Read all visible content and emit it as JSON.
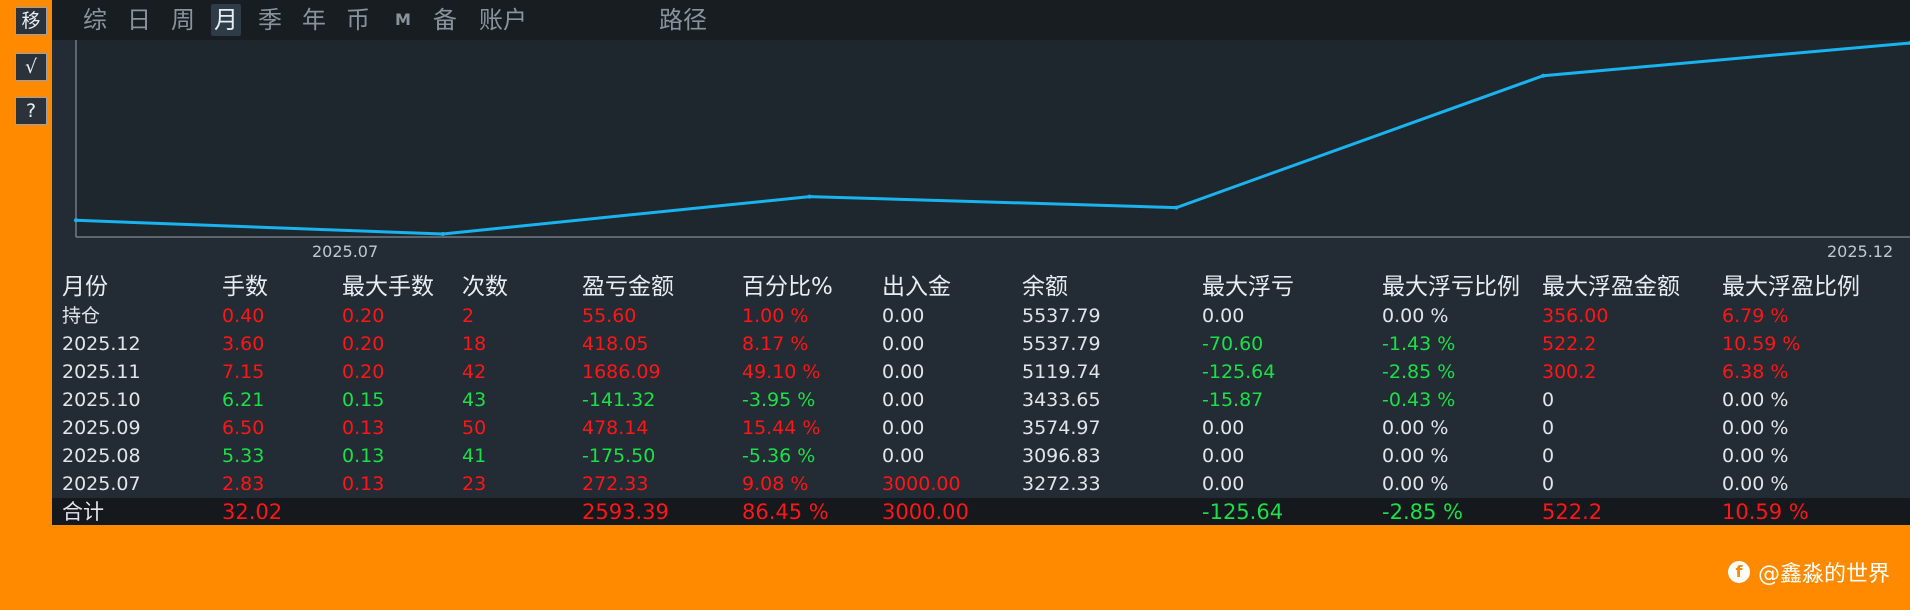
{
  "side_buttons": [
    "移",
    "√",
    "?"
  ],
  "tabs": [
    "综",
    "日",
    "周",
    "月",
    "季",
    "年",
    "币",
    "M",
    "备",
    "账户",
    "路径"
  ],
  "active_tab": "月",
  "chart_data": {
    "type": "line",
    "x": [
      "2025.07",
      "2025.08",
      "2025.09",
      "2025.10",
      "2025.11",
      "2025.12"
    ],
    "series": [
      {
        "values": [
          3272.33,
          3096.83,
          3574.97,
          3433.65,
          5119.74,
          5537.79
        ]
      }
    ],
    "xticks": [
      "2025.07",
      "2025.12"
    ],
    "line_color": "#19b4f0",
    "grid": false
  },
  "table": {
    "headers": [
      "月份",
      "手数",
      "最大手数",
      "次数",
      "盈亏金额",
      "百分比%",
      "出入金",
      "余额",
      "最大浮亏",
      "最大浮亏比例",
      "最大浮盈金额",
      "最大浮盈比例"
    ],
    "rows": [
      [
        "持仓",
        "0.40",
        "0.20",
        "2",
        "55.60",
        "1.00 %",
        "0.00",
        "5537.79",
        "0.00",
        "0.00 %",
        "356.00",
        "6.79 %"
      ],
      [
        "2025.12",
        "3.60",
        "0.20",
        "18",
        "418.05",
        "8.17 %",
        "0.00",
        "5537.79",
        "-70.60",
        "-1.43 %",
        "522.2",
        "10.59 %"
      ],
      [
        "2025.11",
        "7.15",
        "0.20",
        "42",
        "1686.09",
        "49.10 %",
        "0.00",
        "5119.74",
        "-125.64",
        "-2.85 %",
        "300.2",
        "6.38 %"
      ],
      [
        "2025.10",
        "6.21",
        "0.15",
        "43",
        "-141.32",
        "-3.95 %",
        "0.00",
        "3433.65",
        "-15.87",
        "-0.43 %",
        "0",
        "0.00 %"
      ],
      [
        "2025.09",
        "6.50",
        "0.13",
        "50",
        "478.14",
        "15.44 %",
        "0.00",
        "3574.97",
        "0.00",
        "0.00 %",
        "0",
        "0.00 %"
      ],
      [
        "2025.08",
        "5.33",
        "0.13",
        "41",
        "-175.50",
        "-5.36 %",
        "0.00",
        "3096.83",
        "0.00",
        "0.00 %",
        "0",
        "0.00 %"
      ],
      [
        "2025.07",
        "2.83",
        "0.13",
        "23",
        "272.33",
        "9.08 %",
        "3000.00",
        "3272.33",
        "0.00",
        "0.00 %",
        "0",
        "0.00 %"
      ]
    ],
    "row_colors": [
      [
        "w",
        "r",
        "r",
        "r",
        "r",
        "r",
        "w",
        "w",
        "w",
        "w",
        "r",
        "r"
      ],
      [
        "w",
        "r",
        "r",
        "r",
        "r",
        "r",
        "w",
        "w",
        "g",
        "g",
        "r",
        "r"
      ],
      [
        "w",
        "r",
        "r",
        "r",
        "r",
        "r",
        "w",
        "w",
        "g",
        "g",
        "r",
        "r"
      ],
      [
        "w",
        "g",
        "g",
        "g",
        "g",
        "g",
        "w",
        "w",
        "g",
        "g",
        "w",
        "w"
      ],
      [
        "w",
        "r",
        "r",
        "r",
        "r",
        "r",
        "w",
        "w",
        "w",
        "w",
        "w",
        "w"
      ],
      [
        "w",
        "g",
        "g",
        "g",
        "g",
        "g",
        "w",
        "w",
        "w",
        "w",
        "w",
        "w"
      ],
      [
        "w",
        "r",
        "r",
        "r",
        "r",
        "r",
        "r",
        "w",
        "w",
        "w",
        "w",
        "w"
      ]
    ],
    "total": [
      "合计",
      "32.02",
      "",
      "",
      "2593.39",
      "86.45 %",
      "3000.00",
      "",
      "-125.64",
      "-2.85 %",
      "522.2",
      "10.59 %"
    ],
    "total_colors": [
      "w",
      "r",
      "w",
      "w",
      "r",
      "r",
      "r",
      "w",
      "g",
      "g",
      "r",
      "r"
    ]
  },
  "watermark": {
    "icon": "f",
    "text": "@鑫淼的世界"
  }
}
